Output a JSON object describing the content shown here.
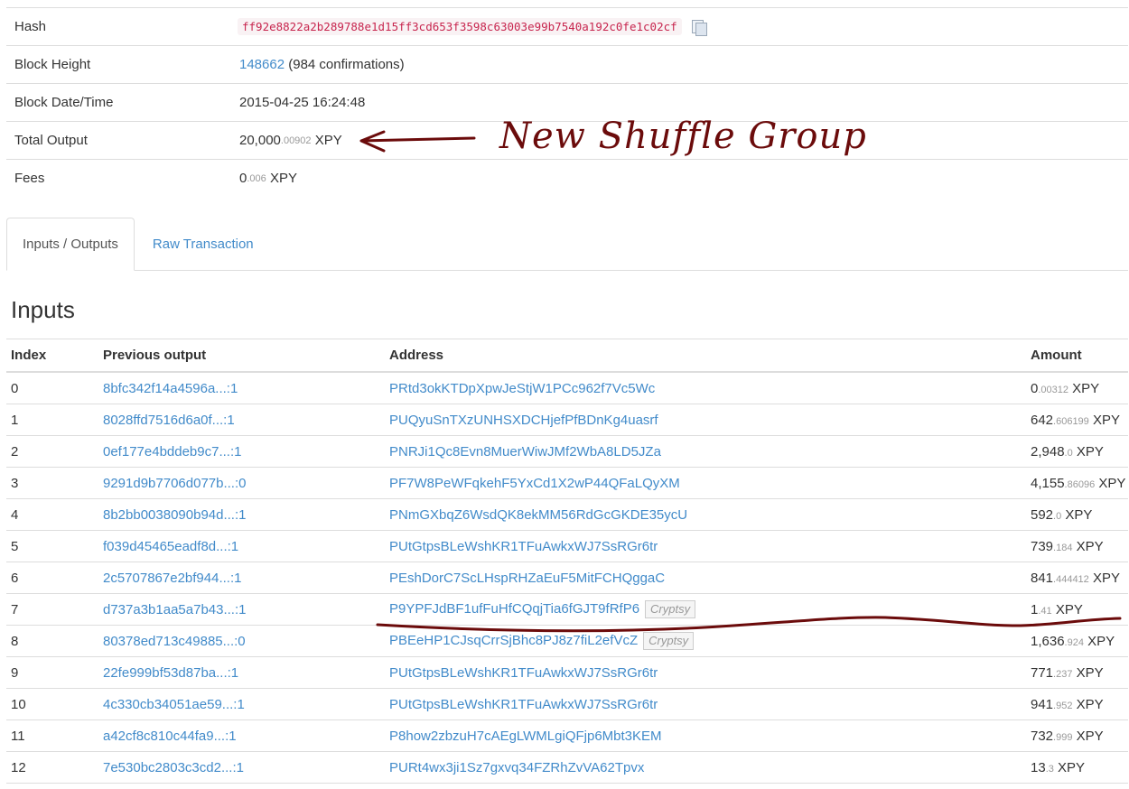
{
  "summary": {
    "hash": {
      "label": "Hash",
      "value": "ff92e8822a2b289788e1d15ff3cd653f3598c63003e99b7540a192c0fe1c02cf"
    },
    "block_height": {
      "label": "Block Height",
      "height": "148662",
      "confirmations": "(984 confirmations)"
    },
    "block_datetime": {
      "label": "Block Date/Time",
      "value": "2015-04-25 16:24:48"
    },
    "total_output": {
      "label": "Total Output",
      "int": "20,000",
      "dec": ".00902",
      "unit": "XPY"
    },
    "fees": {
      "label": "Fees",
      "int": "0",
      "dec": ".006",
      "unit": "XPY"
    }
  },
  "tabs": [
    {
      "label": "Inputs / Outputs",
      "active": true
    },
    {
      "label": "Raw Transaction",
      "active": false
    }
  ],
  "inputs": {
    "title": "Inputs",
    "headers": [
      "Index",
      "Previous output",
      "Address",
      "Amount"
    ],
    "rows": [
      {
        "index": "0",
        "prev": "8bfc342f14a4596a...:1",
        "address": "PRtd3okKTDpXpwJeStjW1PCc962f7Vc5Wc",
        "badge": "",
        "int": "0",
        "dec": ".00312",
        "unit": "XPY"
      },
      {
        "index": "1",
        "prev": "8028ffd7516d6a0f...:1",
        "address": "PUQyuSnTXzUNHSXDCHjefPfBDnKg4uasrf",
        "badge": "",
        "int": "642",
        "dec": ".606199",
        "unit": "XPY"
      },
      {
        "index": "2",
        "prev": "0ef177e4bddeb9c7...:1",
        "address": "PNRJi1Qc8Evn8MuerWiwJMf2WbA8LD5JZa",
        "badge": "",
        "int": "2,948",
        "dec": ".0",
        "unit": "XPY"
      },
      {
        "index": "3",
        "prev": "9291d9b7706d077b...:0",
        "address": "PF7W8PeWFqkehF5YxCd1X2wP44QFaLQyXM",
        "badge": "",
        "int": "4,155",
        "dec": ".86096",
        "unit": "XPY"
      },
      {
        "index": "4",
        "prev": "8b2bb0038090b94d...:1",
        "address": "PNmGXbqZ6WsdQK8ekMM56RdGcGKDE35ycU",
        "badge": "",
        "int": "592",
        "dec": ".0",
        "unit": "XPY"
      },
      {
        "index": "5",
        "prev": "f039d45465eadf8d...:1",
        "address": "PUtGtpsBLeWshKR1TFuAwkxWJ7SsRGr6tr",
        "badge": "",
        "int": "739",
        "dec": ".184",
        "unit": "XPY"
      },
      {
        "index": "6",
        "prev": "2c5707867e2bf944...:1",
        "address": "PEshDorC7ScLHspRHZaEuF5MitFCHQggaC",
        "badge": "",
        "int": "841",
        "dec": ".444412",
        "unit": "XPY"
      },
      {
        "index": "7",
        "prev": "d737a3b1aa5a7b43...:1",
        "address": "P9YPFJdBF1ufFuHfCQqjTia6fGJT9fRfP6",
        "badge": "Cryptsy",
        "int": "1",
        "dec": ".41",
        "unit": "XPY"
      },
      {
        "index": "8",
        "prev": "80378ed713c49885...:0",
        "address": "PBEeHP1CJsqCrrSjBhc8PJ8z7fiL2efVcZ",
        "badge": "Cryptsy",
        "int": "1,636",
        "dec": ".924",
        "unit": "XPY"
      },
      {
        "index": "9",
        "prev": "22fe999bf53d87ba...:1",
        "address": "PUtGtpsBLeWshKR1TFuAwkxWJ7SsRGr6tr",
        "badge": "",
        "int": "771",
        "dec": ".237",
        "unit": "XPY"
      },
      {
        "index": "10",
        "prev": "4c330cb34051ae59...:1",
        "address": "PUtGtpsBLeWshKR1TFuAwkxWJ7SsRGr6tr",
        "badge": "",
        "int": "941",
        "dec": ".952",
        "unit": "XPY"
      },
      {
        "index": "11",
        "prev": "a42cf8c810c44fa9...:1",
        "address": "P8how2zbzuH7cAEgLWMLgiQFjp6Mbt3KEM",
        "badge": "",
        "int": "732",
        "dec": ".999",
        "unit": "XPY"
      },
      {
        "index": "12",
        "prev": "7e530bc2803c3cd2...:1",
        "address": "PURt4wx3ji1Sz7gxvq34FZRhZvVA62Tpvx",
        "badge": "",
        "int": "13",
        "dec": ".3",
        "unit": "XPY"
      }
    ]
  },
  "annotation": {
    "text": "New Shuffle Group",
    "color": "#6b0b0b"
  },
  "colors": {
    "link": "#428bca",
    "hash_text": "#c7254e",
    "hash_bg": "#f9f2f4",
    "border": "#dddddd"
  }
}
